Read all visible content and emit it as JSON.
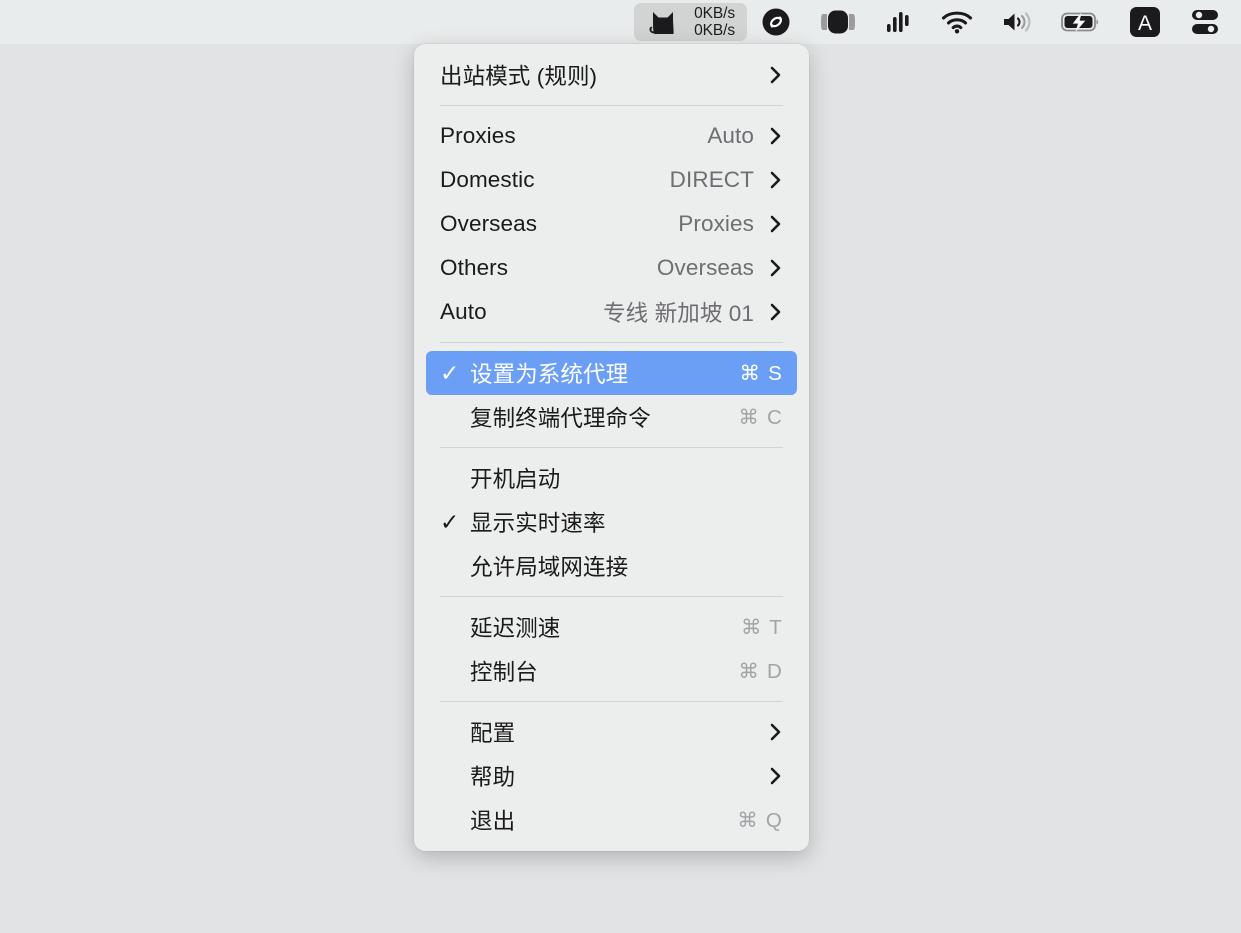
{
  "menubar": {
    "clash": {
      "icon": "cat-icon",
      "speed_up": "0KB/s",
      "speed_down": "0KB/s"
    },
    "status_icons": [
      {
        "name": "shazam-icon"
      },
      {
        "name": "display-icon"
      },
      {
        "name": "audio-levels-icon"
      },
      {
        "name": "wifi-icon"
      },
      {
        "name": "volume-icon"
      },
      {
        "name": "battery-charging-icon"
      },
      {
        "name": "input-source-icon",
        "label": "A"
      },
      {
        "name": "control-center-icon"
      }
    ]
  },
  "menu": {
    "sections": [
      {
        "items": [
          {
            "label": "出站模式 (规则)",
            "chevron": true
          }
        ]
      },
      {
        "items": [
          {
            "label": "Proxies",
            "value": "Auto",
            "chevron": true
          },
          {
            "label": "Domestic",
            "value": "DIRECT",
            "chevron": true
          },
          {
            "label": "Overseas",
            "value": "Proxies",
            "chevron": true
          },
          {
            "label": "Others",
            "value": "Overseas",
            "chevron": true
          },
          {
            "label": "Auto",
            "value": "专线 新加坡 01",
            "chevron": true
          }
        ]
      },
      {
        "items": [
          {
            "label": "设置为系统代理",
            "shortcut": "⌘ S",
            "checked": true,
            "highlight": true
          },
          {
            "label": "复制终端代理命令",
            "shortcut": "⌘ C",
            "indent": true
          }
        ]
      },
      {
        "items": [
          {
            "label": "开机启动",
            "indent": true
          },
          {
            "label": "显示实时速率",
            "checked": true
          },
          {
            "label": "允许局域网连接",
            "indent": true
          }
        ]
      },
      {
        "items": [
          {
            "label": "延迟测速",
            "shortcut": "⌘ T",
            "indent": true
          },
          {
            "label": "控制台",
            "shortcut": "⌘ D",
            "indent": true
          }
        ]
      },
      {
        "items": [
          {
            "label": "配置",
            "chevron": true,
            "indent": true
          },
          {
            "label": "帮助",
            "chevron": true,
            "indent": true
          },
          {
            "label": "退出",
            "shortcut": "⌘ Q",
            "indent": true
          }
        ]
      }
    ]
  },
  "colors": {
    "highlight": "#6b9ff5",
    "menu_bg": "#eceded",
    "menubar_bg": "#e9ecec",
    "desktop_bg": "#e2e3e5"
  }
}
